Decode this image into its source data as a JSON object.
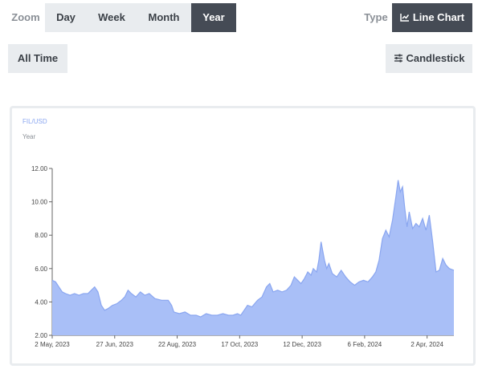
{
  "zoom": {
    "label": "Zoom",
    "buttons": [
      {
        "label": "Day",
        "active": false
      },
      {
        "label": "Week",
        "active": false
      },
      {
        "label": "Month",
        "active": false
      },
      {
        "label": "Year",
        "active": true
      }
    ],
    "all_time_label": "All Time"
  },
  "type": {
    "label": "Type",
    "line_chart_label": "Line Chart",
    "line_chart_icon": "line-chart-icon",
    "candlestick_label": "Candlestick",
    "candlestick_icon": "sliders-icon",
    "active": "line"
  },
  "colors": {
    "accent_dark": "#454b55",
    "button_bg": "#e9ecef",
    "series_fill": "#a9bff7",
    "series_line": "#8aa6f0"
  },
  "chart_data": {
    "type": "area",
    "title": "FIL/USD",
    "subtitle": "Year",
    "xlabel": "",
    "ylabel": "",
    "ylim": [
      2,
      12
    ],
    "yticks": [
      "2.00",
      "4.00",
      "6.00",
      "8.00",
      "10.00",
      "12.00"
    ],
    "xticks": [
      "2 May, 2023",
      "27 Jun, 2023",
      "22 Aug, 2023",
      "17 Oct, 2023",
      "12 Dec, 2023",
      "6 Feb, 2024",
      "2 Apr, 2024"
    ],
    "x_start": "2023-05-02",
    "grid": false,
    "series": [
      {
        "values": [
          [
            "2023-05-02",
            5.3
          ],
          [
            "2023-05-05",
            5.2
          ],
          [
            "2023-05-08",
            4.9
          ],
          [
            "2023-05-11",
            4.6
          ],
          [
            "2023-05-14",
            4.5
          ],
          [
            "2023-05-18",
            4.4
          ],
          [
            "2023-05-22",
            4.5
          ],
          [
            "2023-05-26",
            4.4
          ],
          [
            "2023-05-30",
            4.5
          ],
          [
            "2023-06-03",
            4.5
          ],
          [
            "2023-06-06",
            4.7
          ],
          [
            "2023-06-09",
            4.9
          ],
          [
            "2023-06-12",
            4.6
          ],
          [
            "2023-06-15",
            3.8
          ],
          [
            "2023-06-18",
            3.5
          ],
          [
            "2023-06-21",
            3.6
          ],
          [
            "2023-06-25",
            3.8
          ],
          [
            "2023-06-29",
            3.9
          ],
          [
            "2023-07-03",
            4.1
          ],
          [
            "2023-07-06",
            4.3
          ],
          [
            "2023-07-09",
            4.7
          ],
          [
            "2023-07-12",
            4.5
          ],
          [
            "2023-07-16",
            4.3
          ],
          [
            "2023-07-20",
            4.6
          ],
          [
            "2023-07-24",
            4.4
          ],
          [
            "2023-07-28",
            4.5
          ],
          [
            "2023-08-02",
            4.2
          ],
          [
            "2023-08-08",
            4.1
          ],
          [
            "2023-08-14",
            4.1
          ],
          [
            "2023-08-17",
            3.8
          ],
          [
            "2023-08-19",
            3.4
          ],
          [
            "2023-08-24",
            3.3
          ],
          [
            "2023-08-29",
            3.4
          ],
          [
            "2023-09-03",
            3.2
          ],
          [
            "2023-09-08",
            3.2
          ],
          [
            "2023-09-12",
            3.1
          ],
          [
            "2023-09-17",
            3.3
          ],
          [
            "2023-09-22",
            3.2
          ],
          [
            "2023-09-27",
            3.2
          ],
          [
            "2023-10-02",
            3.3
          ],
          [
            "2023-10-07",
            3.2
          ],
          [
            "2023-10-11",
            3.2
          ],
          [
            "2023-10-15",
            3.3
          ],
          [
            "2023-10-18",
            3.2
          ],
          [
            "2023-10-21",
            3.5
          ],
          [
            "2023-10-24",
            3.8
          ],
          [
            "2023-10-28",
            3.7
          ],
          [
            "2023-11-02",
            4.1
          ],
          [
            "2023-11-06",
            4.3
          ],
          [
            "2023-11-10",
            4.9
          ],
          [
            "2023-11-13",
            5.1
          ],
          [
            "2023-11-16",
            4.6
          ],
          [
            "2023-11-20",
            4.7
          ],
          [
            "2023-11-24",
            4.6
          ],
          [
            "2023-11-28",
            4.7
          ],
          [
            "2023-12-02",
            5.0
          ],
          [
            "2023-12-05",
            5.5
          ],
          [
            "2023-12-08",
            5.3
          ],
          [
            "2023-12-11",
            5.1
          ],
          [
            "2023-12-14",
            5.4
          ],
          [
            "2023-12-17",
            5.8
          ],
          [
            "2023-12-20",
            5.6
          ],
          [
            "2023-12-22",
            6.0
          ],
          [
            "2023-12-25",
            5.8
          ],
          [
            "2023-12-27",
            6.5
          ],
          [
            "2023-12-29",
            7.6
          ],
          [
            "2024-01-01",
            6.5
          ],
          [
            "2024-01-03",
            6.0
          ],
          [
            "2024-01-05",
            6.3
          ],
          [
            "2024-01-08",
            5.7
          ],
          [
            "2024-01-12",
            5.5
          ],
          [
            "2024-01-16",
            5.9
          ],
          [
            "2024-01-20",
            5.5
          ],
          [
            "2024-01-24",
            5.2
          ],
          [
            "2024-01-28",
            5.0
          ],
          [
            "2024-02-01",
            5.2
          ],
          [
            "2024-02-05",
            5.3
          ],
          [
            "2024-02-09",
            5.2
          ],
          [
            "2024-02-13",
            5.5
          ],
          [
            "2024-02-16",
            5.8
          ],
          [
            "2024-02-19",
            6.5
          ],
          [
            "2024-02-22",
            7.8
          ],
          [
            "2024-02-25",
            8.3
          ],
          [
            "2024-02-28",
            7.9
          ],
          [
            "2024-03-02",
            8.9
          ],
          [
            "2024-03-05",
            10.3
          ],
          [
            "2024-03-07",
            11.3
          ],
          [
            "2024-03-09",
            10.6
          ],
          [
            "2024-03-11",
            10.9
          ],
          [
            "2024-03-13",
            9.6
          ],
          [
            "2024-03-15",
            8.5
          ],
          [
            "2024-03-17",
            9.4
          ],
          [
            "2024-03-20",
            8.4
          ],
          [
            "2024-03-23",
            8.7
          ],
          [
            "2024-03-26",
            8.5
          ],
          [
            "2024-03-29",
            9.0
          ],
          [
            "2024-04-01",
            8.3
          ],
          [
            "2024-04-04",
            9.2
          ],
          [
            "2024-04-07",
            7.6
          ],
          [
            "2024-04-10",
            5.8
          ],
          [
            "2024-04-13",
            5.9
          ],
          [
            "2024-04-16",
            6.6
          ],
          [
            "2024-04-19",
            6.2
          ],
          [
            "2024-04-22",
            6.0
          ],
          [
            "2024-04-26",
            5.9
          ]
        ]
      }
    ]
  }
}
